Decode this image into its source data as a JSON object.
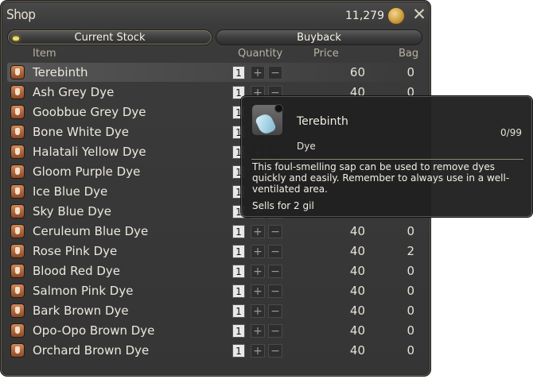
{
  "window": {
    "title": "Shop",
    "gil": "11,279"
  },
  "tabs": [
    {
      "label": "Current Stock",
      "active": true
    },
    {
      "label": "Buyback",
      "active": false
    }
  ],
  "columns": {
    "item": "Item",
    "quantity": "Quantity",
    "price": "Price",
    "bag": "Bag"
  },
  "items": [
    {
      "name": "Terebinth",
      "qty": "1",
      "price": "60",
      "bag": "0"
    },
    {
      "name": "Ash Grey Dye",
      "qty": "1",
      "price": "40",
      "bag": "0"
    },
    {
      "name": "Goobbue Grey Dye",
      "qty": "1",
      "price": "",
      "bag": ""
    },
    {
      "name": "Bone White Dye",
      "qty": "1",
      "price": "",
      "bag": ""
    },
    {
      "name": "Halatali Yellow Dye",
      "qty": "1",
      "price": "",
      "bag": ""
    },
    {
      "name": "Gloom Purple Dye",
      "qty": "1",
      "price": "",
      "bag": ""
    },
    {
      "name": "Ice Blue Dye",
      "qty": "1",
      "price": "",
      "bag": ""
    },
    {
      "name": "Sky Blue Dye",
      "qty": "1",
      "price": "",
      "bag": ""
    },
    {
      "name": "Ceruleum Blue Dye",
      "qty": "1",
      "price": "40",
      "bag": "0"
    },
    {
      "name": "Rose Pink Dye",
      "qty": "1",
      "price": "40",
      "bag": "2"
    },
    {
      "name": "Blood Red Dye",
      "qty": "1",
      "price": "40",
      "bag": "0"
    },
    {
      "name": "Salmon Pink Dye",
      "qty": "1",
      "price": "40",
      "bag": "0"
    },
    {
      "name": "Bark Brown Dye",
      "qty": "1",
      "price": "40",
      "bag": "0"
    },
    {
      "name": "Opo-Opo Brown Dye",
      "qty": "1",
      "price": "40",
      "bag": "0"
    },
    {
      "name": "Orchard Brown Dye",
      "qty": "1",
      "price": "40",
      "bag": "0"
    }
  ],
  "qty_buttons": {
    "plus": "+",
    "minus": "−"
  },
  "tooltip": {
    "name": "Terebinth",
    "count": "0/99",
    "category": "Dye",
    "description": "This foul-smelling sap can be used to remove dyes quickly and easily. Remember to always use in a well-ventilated area.",
    "sell": "Sells for 2 gil"
  },
  "icons": {
    "close": "close-icon",
    "gil": "gil-coin-icon",
    "item": "dye-bottle-icon"
  },
  "colors": {
    "accent_led": "#f3dd64",
    "gil_gold": "#c99a3e",
    "item_icon": "#b86c3e"
  }
}
